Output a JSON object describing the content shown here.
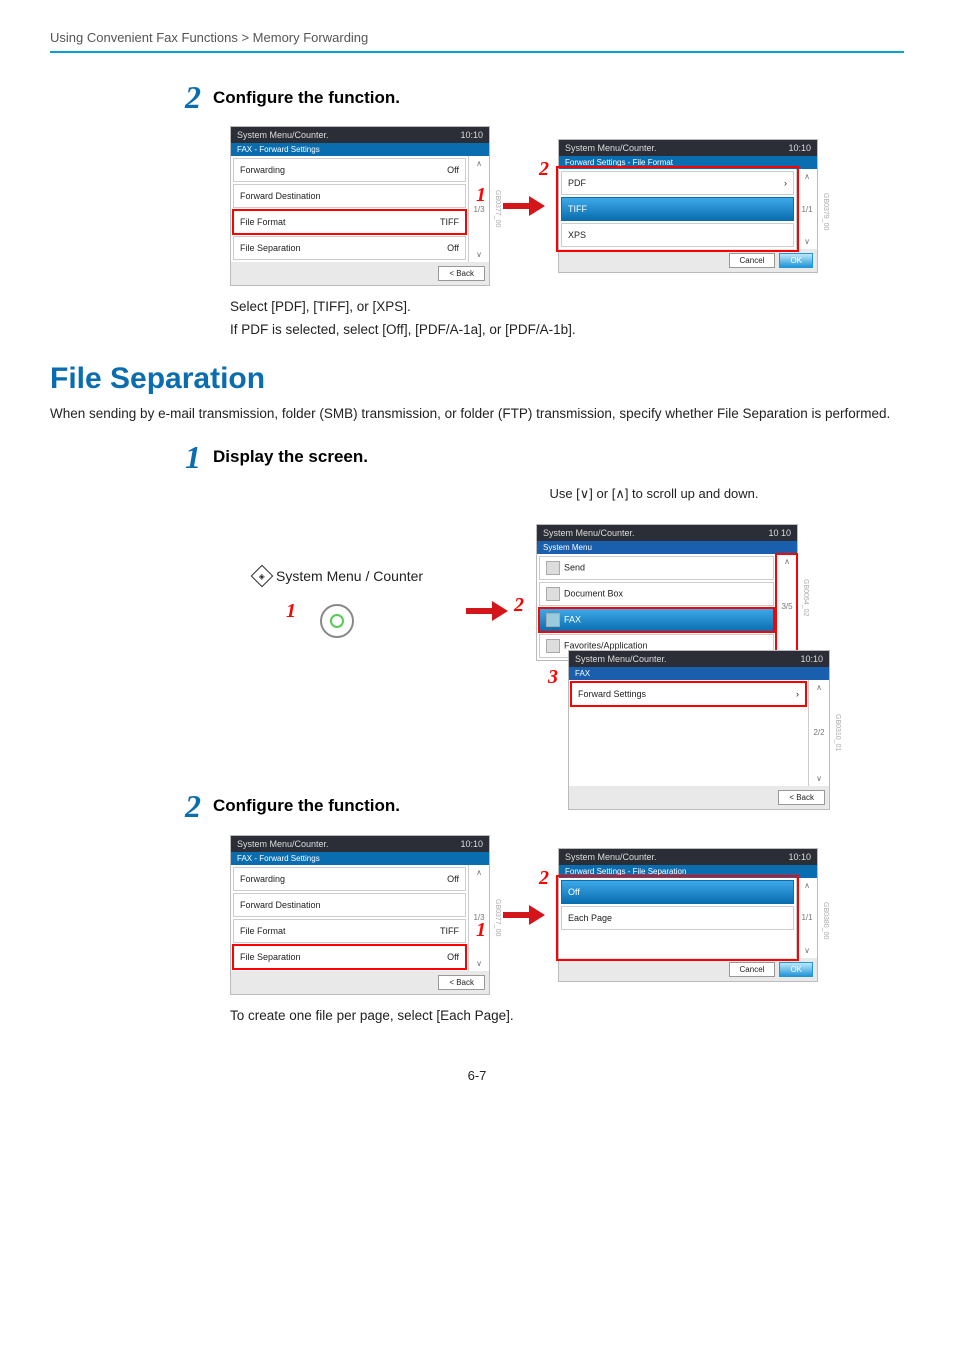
{
  "breadcrumb": "Using Convenient Fax Functions > Memory Forwarding",
  "s2": {
    "num": "2",
    "title": "Configure the function."
  },
  "p1_left": {
    "top": "System Menu/Counter.",
    "time": "10:10",
    "sub": "FAX - Forward Settings",
    "r1": {
      "l": "Forwarding",
      "v": "Off"
    },
    "r2": {
      "l": "Forward Destination",
      "v": ""
    },
    "r3": {
      "l": "File Format",
      "v": "TIFF"
    },
    "r4": {
      "l": "File Separation",
      "v": "Off"
    },
    "page": "1/3",
    "back": "< Back",
    "ref": "GB0377_00"
  },
  "p1_right": {
    "top": "System Menu/Counter.",
    "time": "10:10",
    "sub": "Forward Settings - File Format",
    "r1": "PDF",
    "r2": "TIFF",
    "r3": "XPS",
    "page": "1/1",
    "cancel": "Cancel",
    "ok": "OK",
    "ref": "GB0379_00"
  },
  "prose1a": "Select [PDF], [TIFF], or [XPS].",
  "prose1b": "If PDF is selected, select [Off], [PDF/A-1a], or [PDF/A-1b].",
  "h2": "File Separation",
  "para": "When sending by e-mail transmission, folder (SMB) transmission, or folder (FTP) transmission, specify whether File Separation is performed.",
  "s1b": {
    "num": "1",
    "title": "Display the screen."
  },
  "hint": "Use [∨] or [∧] to scroll up and down.",
  "sysmenu": "System Menu / Counter",
  "n1": "1",
  "n2": "2",
  "n3": "3",
  "pA": {
    "top": "System Menu/Counter.",
    "time": "10",
    "time2": "10",
    "sub": "System Menu",
    "r1": "Send",
    "r2": "Document Box",
    "r3": "FAX",
    "r4": "Favorites/Application",
    "page": "3/5",
    "ref": "GB0054_02"
  },
  "pB": {
    "top": "System Menu/Counter.",
    "time": "10:10",
    "sub": "FAX",
    "r1": "Forward Settings",
    "page": "2/2",
    "back": "< Back",
    "ref": "GB0310_01"
  },
  "s2b": {
    "num": "2",
    "title": "Configure the function."
  },
  "p2_left": {
    "top": "System Menu/Counter.",
    "time": "10:10",
    "sub": "FAX - Forward Settings",
    "r1": {
      "l": "Forwarding",
      "v": "Off"
    },
    "r2": {
      "l": "Forward Destination",
      "v": ""
    },
    "r3": {
      "l": "File Format",
      "v": "TIFF"
    },
    "r4": {
      "l": "File Separation",
      "v": "Off"
    },
    "page": "1/3",
    "back": "< Back",
    "ref": "GB0377_00"
  },
  "p2_right": {
    "top": "System Menu/Counter.",
    "time": "10:10",
    "sub": "Forward Settings - File Separation",
    "r1": "Off",
    "r2": "Each Page",
    "page": "1/1",
    "cancel": "Cancel",
    "ok": "OK",
    "ref": "GB0380_00"
  },
  "prose2": "To create one file per page, select [Each Page].",
  "pageno": "6-7"
}
